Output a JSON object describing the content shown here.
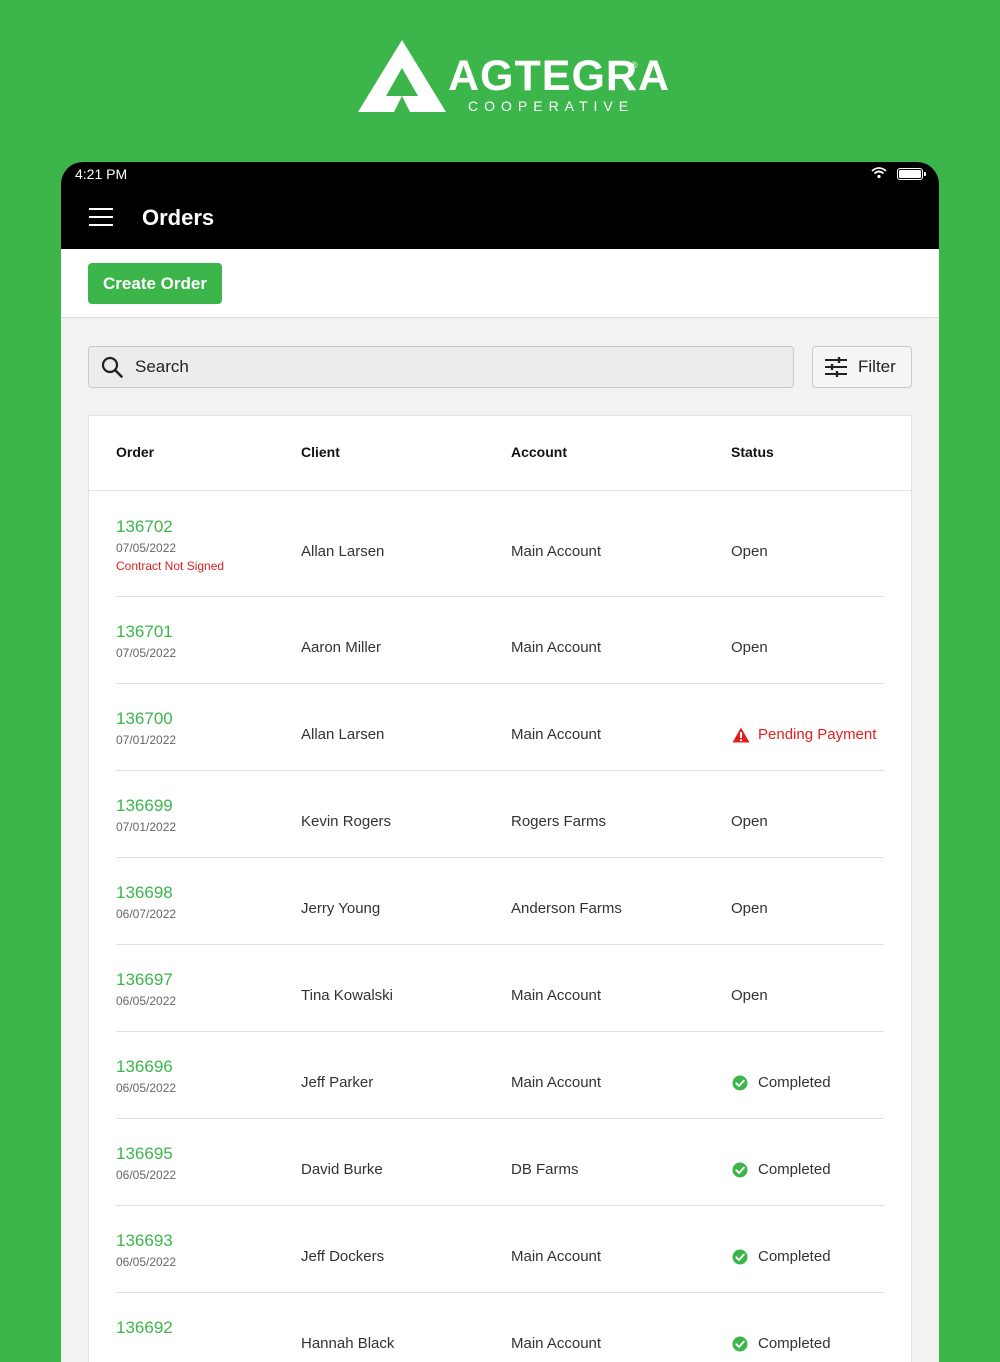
{
  "brand": {
    "name": "AGTEGRA",
    "subtitle": "COOPERATIVE",
    "registered": "®"
  },
  "status_bar": {
    "time": "4:21 PM"
  },
  "app_bar": {
    "title": "Orders"
  },
  "toolbar": {
    "create_label": "Create Order"
  },
  "search": {
    "placeholder": "Search"
  },
  "filter": {
    "label": "Filter"
  },
  "colors": {
    "brand_green": "#3cb64a",
    "alert_red": "#e02020",
    "bar_black": "#000000"
  },
  "table": {
    "headers": {
      "order": "Order",
      "client": "Client",
      "account": "Account",
      "status": "Status"
    },
    "rows": [
      {
        "order": "136702",
        "date": "07/05/2022",
        "note": "Contract Not Signed",
        "client": "Allan Larsen",
        "account": "Main Account",
        "status": "Open",
        "status_icon": ""
      },
      {
        "order": "136701",
        "date": "07/05/2022",
        "note": "",
        "client": "Aaron Miller",
        "account": "Main Account",
        "status": "Open",
        "status_icon": ""
      },
      {
        "order": "136700",
        "date": "07/01/2022",
        "note": "",
        "client": "Allan Larsen",
        "account": "Main Account",
        "status": "Pending Payment",
        "status_icon": "warning-icon"
      },
      {
        "order": "136699",
        "date": "07/01/2022",
        "note": "",
        "client": "Kevin Rogers",
        "account": "Rogers Farms",
        "status": "Open",
        "status_icon": ""
      },
      {
        "order": "136698",
        "date": "06/07/2022",
        "note": "",
        "client": "Jerry Young",
        "account": "Anderson Farms",
        "status": "Open",
        "status_icon": ""
      },
      {
        "order": "136697",
        "date": "06/05/2022",
        "note": "",
        "client": "Tina Kowalski",
        "account": "Main Account",
        "status": "Open",
        "status_icon": ""
      },
      {
        "order": "136696",
        "date": "06/05/2022",
        "note": "",
        "client": "Jeff Parker",
        "account": "Main Account",
        "status": "Completed",
        "status_icon": "check-circle-icon"
      },
      {
        "order": "136695",
        "date": "06/05/2022",
        "note": "",
        "client": "David Burke",
        "account": "DB Farms",
        "status": "Completed",
        "status_icon": "check-circle-icon"
      },
      {
        "order": "136693",
        "date": "06/05/2022",
        "note": "",
        "client": "Jeff Dockers",
        "account": "Main Account",
        "status": "Completed",
        "status_icon": "check-circle-icon"
      },
      {
        "order": "136692",
        "date": "",
        "note": "",
        "client": "Hannah Black",
        "account": "Main Account",
        "status": "Completed",
        "status_icon": "check-circle-icon"
      }
    ]
  }
}
